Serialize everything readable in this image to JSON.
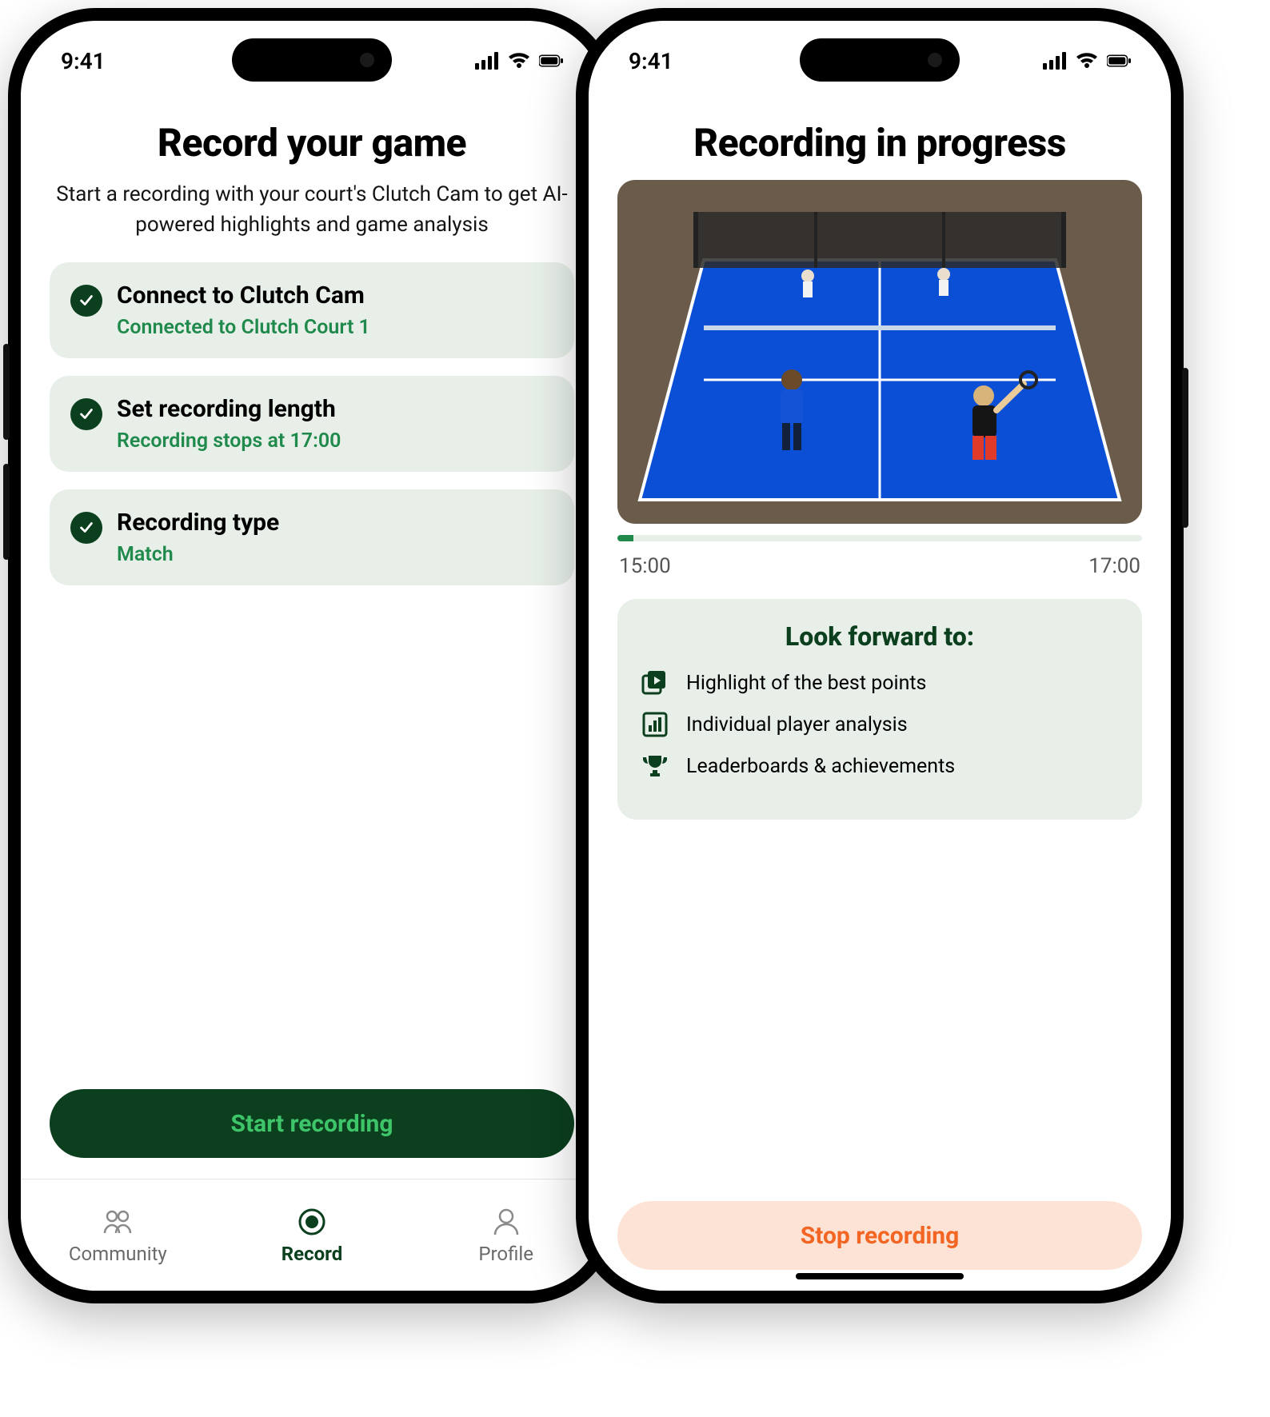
{
  "status": {
    "time": "9:41"
  },
  "left": {
    "title": "Record your game",
    "subtitle": "Start a recording with your court's Clutch Cam to get AI-powered highlights and game analysis",
    "steps": [
      {
        "title": "Connect to Clutch Cam",
        "subtitle": "Connected to Clutch Court 1"
      },
      {
        "title": "Set recording length",
        "subtitle": "Recording stops at 17:00"
      },
      {
        "title": "Recording type",
        "subtitle": "Match"
      }
    ],
    "cta": "Start recording",
    "tabs": {
      "community": "Community",
      "record": "Record",
      "profile": "Profile"
    }
  },
  "right": {
    "title": "Recording in progress",
    "time_start": "15:00",
    "time_end": "17:00",
    "look_title": "Look forward to:",
    "look_items": [
      "Highlight of the best points",
      "Individual player analysis",
      "Leaderboards & achievements"
    ],
    "cta": "Stop recording"
  }
}
